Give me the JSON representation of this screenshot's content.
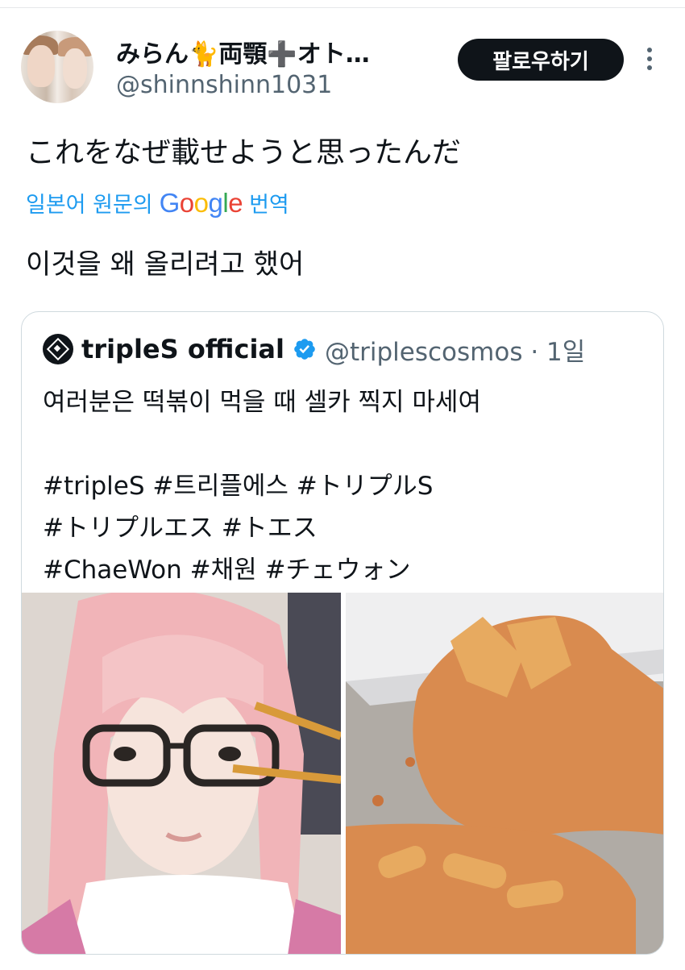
{
  "author": {
    "display_name": "みらん🐈両顎➕オト…",
    "handle": "@shinnshinn1031"
  },
  "follow_button_label": "팔로우하기",
  "tweet": {
    "text": "これをなぜ載せようと思ったんだ",
    "translate_prefix": "일본어 원문의",
    "translate_brand": "Google",
    "translate_suffix": "번역",
    "translated_text": "이것을 왜 올리려고 했어"
  },
  "quote": {
    "name": "tripleS official",
    "handle_time": "@triplescosmos · 1일",
    "text": "여러분은 떡볶이 먹을 때 셀카 찍지 마세여\n\n#tripleS #트리플에스 #トリプルS\n#トリプルエス #トエス\n#ChaeWon #채원 #チェウォン"
  },
  "colors": {
    "accent_link": "#1d9bf0",
    "follow_button_bg": "#0f1419",
    "verified_badge": "#1d9bf0",
    "secondary_text": "#536471"
  },
  "icons": [
    "more-options-icon",
    "verified-badge-icon",
    "triples-logo-icon"
  ]
}
